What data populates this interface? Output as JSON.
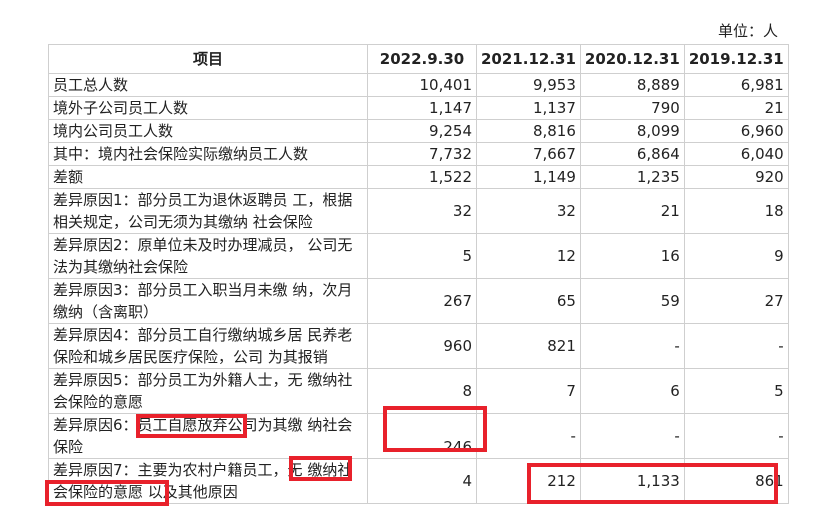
{
  "unit": "单位：人",
  "headers": [
    "项目",
    "2022.9.30",
    "2021.12.31",
    "2020.12.31",
    "2019.12.31"
  ],
  "rows": [
    {
      "label": "员工总人数",
      "values": [
        "10,401",
        "9,953",
        "8,889",
        "6,981"
      ]
    },
    {
      "label": "境外子公司员工人数",
      "values": [
        "1,147",
        "1,137",
        "790",
        "21"
      ]
    },
    {
      "label": "境内公司员工人数",
      "values": [
        "9,254",
        "8,816",
        "8,099",
        "6,960"
      ]
    },
    {
      "label": "其中：境内社会保险实际缴纳员工人数",
      "values": [
        "7,732",
        "7,667",
        "6,864",
        "6,040"
      ]
    },
    {
      "label": "差额",
      "values": [
        "1,522",
        "1,149",
        "1,235",
        "920"
      ]
    },
    {
      "label": "差异原因1：部分员工为退休返聘员 工，根据相关规定，公司无须为其缴纳 社会保险",
      "values": [
        "32",
        "32",
        "21",
        "18"
      ]
    },
    {
      "label": "差异原因2：原单位未及时办理减员， 公司无法为其缴纳社会保险",
      "values": [
        "5",
        "12",
        "16",
        "9"
      ]
    },
    {
      "label": "差异原因3：部分员工入职当月未缴 纳，次月缴纳（含离职）",
      "values": [
        "267",
        "65",
        "59",
        "27"
      ]
    },
    {
      "label": "差异原因4：部分员工自行缴纳城乡居 民养老保险和城乡居民医疗保险，公司 为其报销",
      "values": [
        "960",
        "821",
        "-",
        "-"
      ]
    },
    {
      "label": "差异原因5：部分员工为外籍人士，无 缴纳社会保险的意愿",
      "values": [
        "8",
        "7",
        "6",
        "5"
      ]
    },
    {
      "label": "差异原因6：员工自愿放弃公司为其缴 纳社会保险",
      "values": [
        "246",
        "-",
        "-",
        "-"
      ]
    },
    {
      "label": "差异原因7：主要为农村户籍员工，无 缴纳社会保险的意愿  以及其他原因",
      "values": [
        "4",
        "212",
        "1,133",
        "861"
      ]
    }
  ],
  "highlight_color": "#e8212b"
}
